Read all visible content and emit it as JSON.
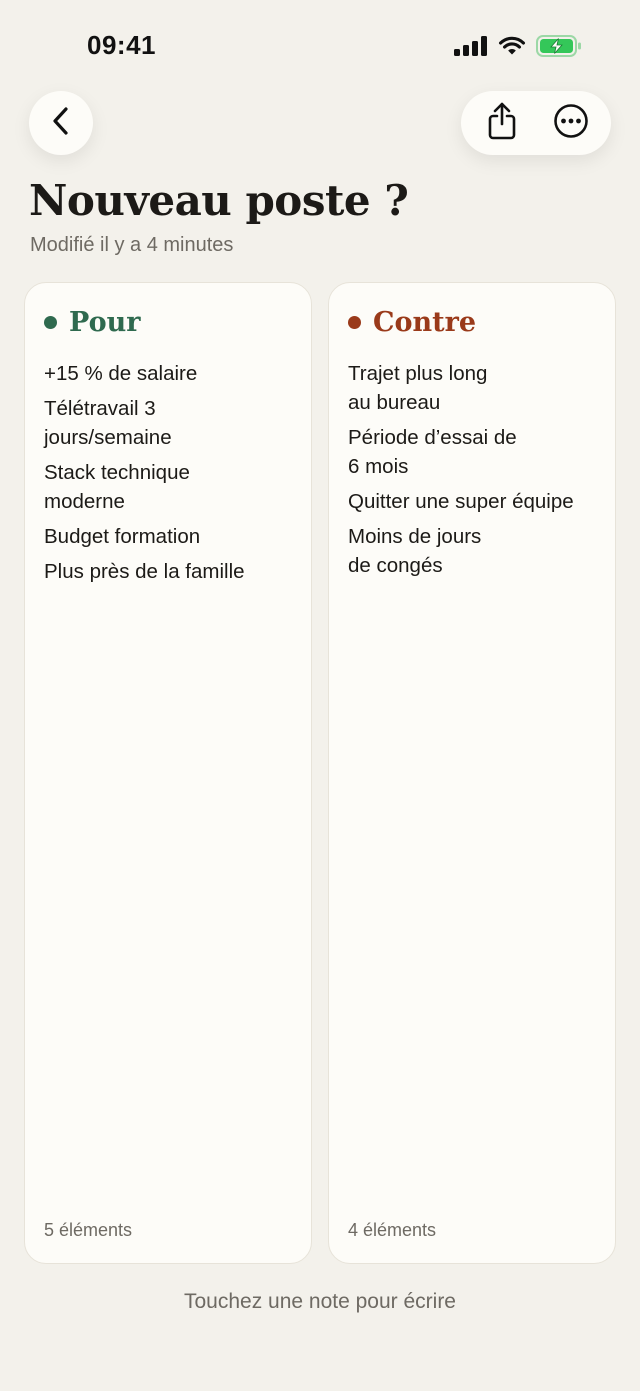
{
  "status_bar": {
    "time": "09:41",
    "icons": [
      "cellular-signal-icon",
      "wifi-icon",
      "battery-charging-icon"
    ]
  },
  "nav": {
    "back_icon": "chevron-left-icon",
    "share_icon": "share-icon",
    "more_icon": "ellipsis-circle-icon"
  },
  "header": {
    "title": "Nouveau poste ?",
    "subtitle": "Modifié il y a 4 minutes"
  },
  "columns": [
    {
      "title": "Pour",
      "accent": "#2f6a4f",
      "items": [
        "+15 % de salaire",
        "Télétravail 3\njours/semaine",
        "Stack technique\nmoderne",
        "Budget formation",
        "Plus près de la famille"
      ],
      "count": "5 éléments"
    },
    {
      "title": "Contre",
      "accent": "#9a3a1a",
      "items": [
        "Trajet plus long\nau bureau",
        "Période d’essai de\n6 mois",
        "Quitter une super équipe",
        "Moins de jours\nde congés"
      ],
      "count": "4 éléments"
    }
  ],
  "footer": {
    "hint": "Touchez une note pour écrire"
  },
  "colors": {
    "background": "#f3f1eb",
    "card": "#fdfcf8",
    "battery": "#34c759"
  }
}
